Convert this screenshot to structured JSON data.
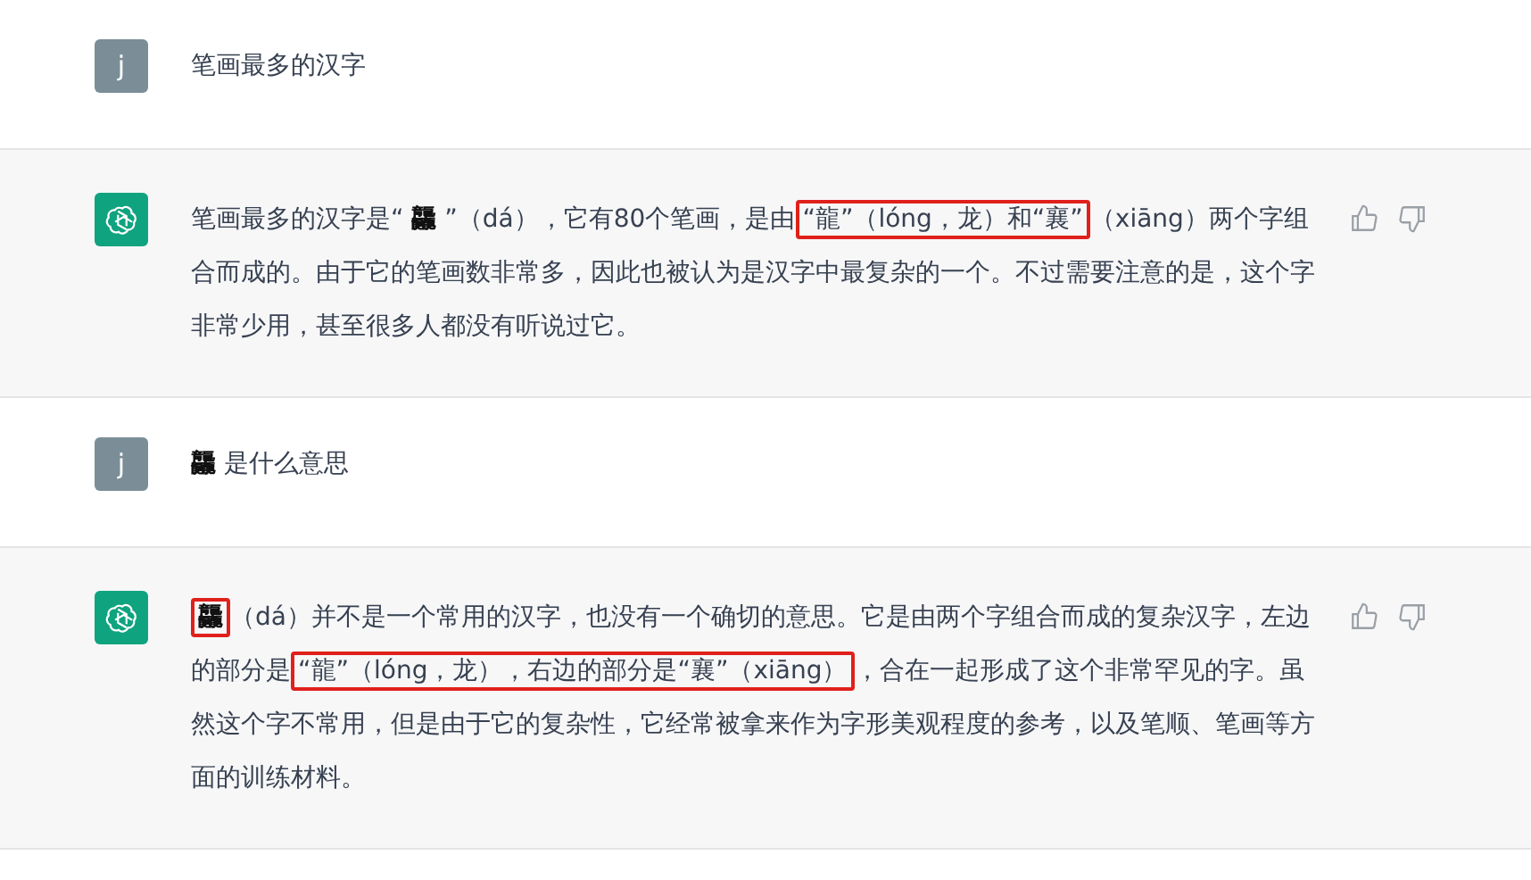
{
  "messages": [
    {
      "kind": "user",
      "avatar": "j",
      "segments": [
        {
          "text": "笔画最多的汉字",
          "highlighted": false
        }
      ]
    },
    {
      "kind": "assistant",
      "segments": [
        {
          "text": "笔画最多的汉字是“ **龘** ”（dá），它有80个笔画，是由",
          "highlighted": false
        },
        {
          "text": "“龍”（lóng，龙）和“襄”",
          "highlighted": true
        },
        {
          "text": "（xiāng）两个字组合而成的。由于它的笔画数非常多，因此也被认为是汉字中最复杂的一个。不过需要注意的是，这个字非常少用，甚至很多人都没有听说过它。",
          "highlighted": false
        }
      ]
    },
    {
      "kind": "user",
      "avatar": "j",
      "segments": [
        {
          "text": "**龘** 是什么意思",
          "highlighted": false
        }
      ]
    },
    {
      "kind": "assistant",
      "segments": [
        {
          "text": "**龘**",
          "highlighted": true
        },
        {
          "text": "（dá）并不是一个常用的汉字，也没有一个确切的意思。它是由两个字组合而成的复杂汉字，左边的部分是",
          "highlighted": false
        },
        {
          "text": "“龍”（lóng，龙），右边的部分是“襄”（xiāng）",
          "highlighted": true
        },
        {
          "text": "，合在一起形成了这个非常罕见的字。虽然这个字不常用，但是由于它的复杂性，它经常被拿来作为字形美观程度的参考，以及笔顺、笔画等方面的训练材料。",
          "highlighted": false
        }
      ]
    }
  ]
}
